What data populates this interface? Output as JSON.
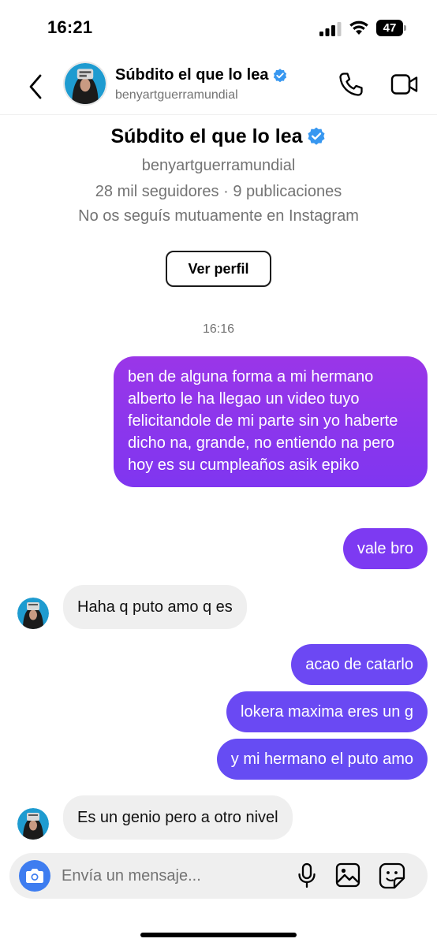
{
  "status_bar": {
    "time": "16:21",
    "battery": "47"
  },
  "header": {
    "name": "Súbdito el que lo lea",
    "username": "benyartguerramundial",
    "icons": [
      "back-icon",
      "verified-icon",
      "phone-icon",
      "video-icon"
    ]
  },
  "profile": {
    "name": "Súbdito el que lo lea",
    "username": "benyartguerramundial",
    "stats": "28 mil seguidores · 9 publicaciones",
    "mutual": "No os seguís mutuamente en Instagram",
    "view_profile_label": "Ver perfil"
  },
  "timestamp": "16:16",
  "messages": [
    {
      "from": "me",
      "text": "ben de alguna forma a mi hermano alberto le ha llegao un video tuyo felicitandole de mi parte sin yo haberte dicho na, grande, no entiendo na pero hoy es su cumpleaños asik epiko"
    },
    {
      "from": "me",
      "text": "vale bro"
    },
    {
      "from": "them",
      "text": "Haha q puto amo q es"
    },
    {
      "from": "me",
      "text": "acao de catarlo"
    },
    {
      "from": "me",
      "text": "lokera maxima eres un g"
    },
    {
      "from": "me",
      "text": "y mi hermano el puto amo"
    },
    {
      "from": "them",
      "text": "Es un genio pero a otro nivel"
    }
  ],
  "composer": {
    "placeholder": "Envía un mensaje...",
    "icons": [
      "camera-icon",
      "mic-icon",
      "gallery-icon",
      "sticker-icon"
    ]
  },
  "colors": {
    "sent_bubble": "#7a38f0",
    "received_bubble": "#efefef",
    "verified": "#3797f0",
    "camera_button": "#3e7df0"
  }
}
